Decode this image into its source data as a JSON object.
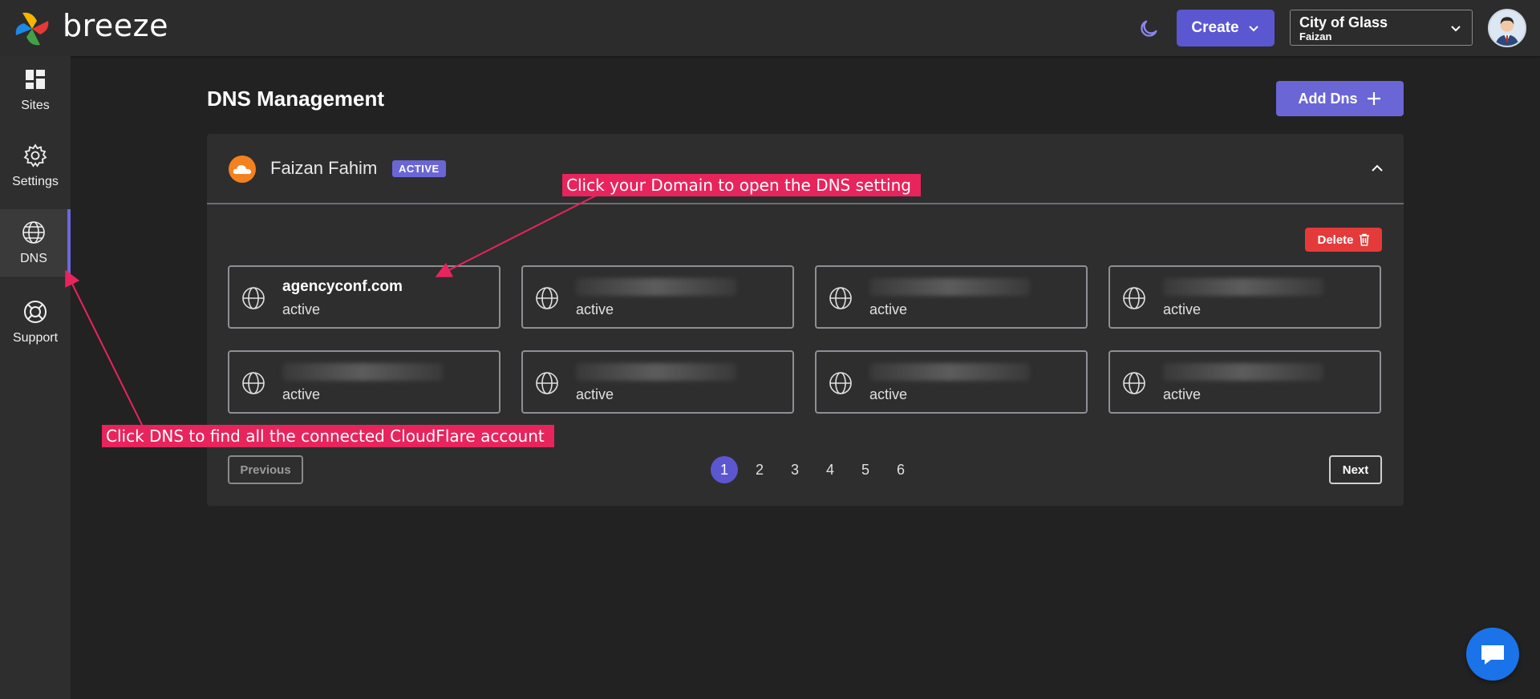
{
  "header": {
    "brand": "breeze",
    "create_label": "Create",
    "site_selector": {
      "name": "City of Glass",
      "owner": "Faizan"
    }
  },
  "sidebar": {
    "items": [
      {
        "label": "Sites",
        "icon": "dashboard-icon"
      },
      {
        "label": "Settings",
        "icon": "gear-icon"
      },
      {
        "label": "DNS",
        "icon": "globe-icon",
        "active": true
      },
      {
        "label": "Support",
        "icon": "lifebuoy-icon"
      }
    ]
  },
  "main": {
    "title": "DNS Management",
    "add_label": "Add Dns",
    "account": {
      "name": "Faizan Fahim",
      "status": "ACTIVE",
      "delete_label": "Delete",
      "domains": [
        {
          "name": "agencyconf.com",
          "status": "active"
        },
        {
          "name": "",
          "status": "active"
        },
        {
          "name": "",
          "status": "active"
        },
        {
          "name": "",
          "status": "active"
        },
        {
          "name": "",
          "status": "active"
        },
        {
          "name": "",
          "status": "active"
        },
        {
          "name": "",
          "status": "active"
        },
        {
          "name": "",
          "status": "active"
        }
      ]
    },
    "pagination": {
      "previous_label": "Previous",
      "next_label": "Next",
      "pages": [
        "1",
        "2",
        "3",
        "4",
        "5",
        "6"
      ],
      "current": "1"
    }
  },
  "annotations": {
    "domain_hint": "Click your Domain to open the DNS setting",
    "dns_hint": "Click DNS to find all the connected CloudFlare account"
  },
  "colors": {
    "accent": "#5b57d1",
    "badge": "#6a66d6",
    "danger": "#e53a3a",
    "annotation": "#e8245d",
    "cloudflare": "#f48120",
    "chat": "#1a73e8"
  }
}
